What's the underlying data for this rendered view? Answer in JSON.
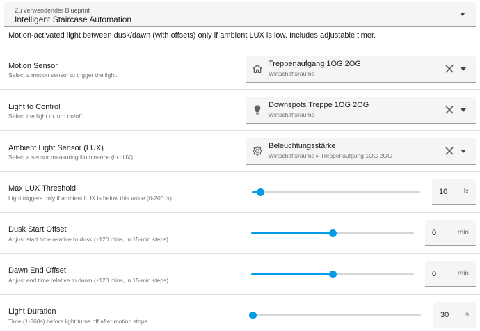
{
  "blueprint": {
    "label": "Zu verwendender Blueprint",
    "value": "Intelligent Staircase Automation",
    "icon": "chevron-down-icon"
  },
  "description": "Motion-activated light between dusk/dawn (with offsets) only if ambient LUX is low. Includes adjustable timer.",
  "pickers": [
    {
      "title": "Motion Sensor",
      "subtitle": "Select a motion sensor to trigger the light.",
      "icon": "home-icon",
      "entity_name": "Treppenaufgang 1OG 2OG",
      "entity_area": "Wirtschaftsräume"
    },
    {
      "title": "Light to Control",
      "subtitle": "Select the light to turn on/off.",
      "icon": "lightbulb-icon",
      "entity_name": "Downspots Treppe 1OG 2OG",
      "entity_area": "Wirtschaftsräume"
    },
    {
      "title": "Ambient Light Sensor (LUX)",
      "subtitle": "Select a sensor measuring illuminance (in LUX).",
      "icon": "brightness-icon",
      "entity_name": "Beleuchtungsstärke",
      "entity_area": "Wirtschaftsräume ▸ Treppenaufgang 1OG 2OG"
    }
  ],
  "sliders": [
    {
      "title": "Max LUX Threshold",
      "subtitle": "Light triggers only if ambient LUX is below this value (0-200 lx).",
      "value": "10",
      "unit": "lx",
      "fraction": 0.05
    },
    {
      "title": "Dusk Start Offset",
      "subtitle": "Adjust start time relative to dusk (±120 mins, in 15-min steps).",
      "value": "0",
      "unit": "min",
      "fraction": 0.5
    },
    {
      "title": "Dawn End Offset",
      "subtitle": "Adjust end time relative to dawn (±120 mins, in 15-min steps).",
      "value": "0",
      "unit": "min",
      "fraction": 0.5
    },
    {
      "title": "Light Duration",
      "subtitle": "Time (1-360s) before light turns off after motion stops.",
      "value": "30",
      "unit": "s",
      "fraction": 0.0
    }
  ],
  "colors": {
    "accent": "#039be5",
    "icon": "#616161"
  }
}
